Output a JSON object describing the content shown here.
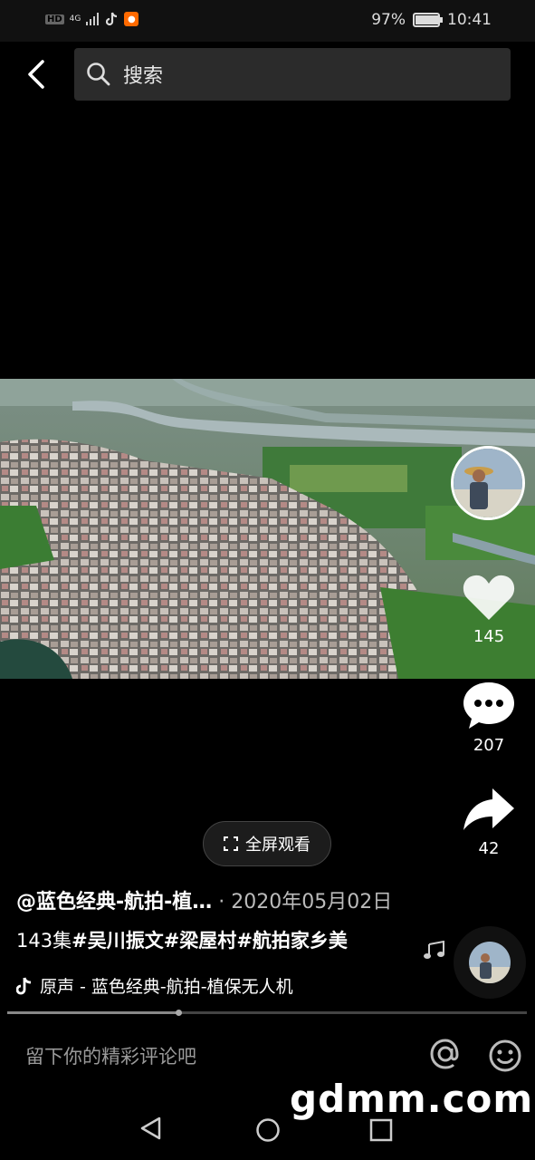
{
  "status_bar": {
    "network_badge": "HD",
    "network_type": "4G",
    "battery": "97%",
    "battery_level": 0.97,
    "time": "10:41"
  },
  "search": {
    "placeholder": "搜索"
  },
  "post": {
    "author": "@蓝色经典-航拍-植…",
    "date": "· 2020年05月02日",
    "caption_prefix": "143集",
    "hashtags": [
      "#吴川振文",
      "#梁屋村",
      "#航拍家乡美"
    ],
    "music": "原声 - 蓝色经典-航拍-植保无人机"
  },
  "actions": {
    "likes": "145",
    "comments": "207",
    "shares": "42"
  },
  "fullscreen": {
    "label": "全屏观看"
  },
  "progress": {
    "value": 0.33
  },
  "comment_bar": {
    "placeholder": "留下你的精彩评论吧"
  },
  "watermark": "gdmm.com",
  "icons": [
    "back-icon",
    "search-icon",
    "heart-icon",
    "comment-icon",
    "share-icon",
    "fullscreen-icon",
    "music-note-icon",
    "at-icon",
    "emoji-icon",
    "tiktok-icon"
  ]
}
